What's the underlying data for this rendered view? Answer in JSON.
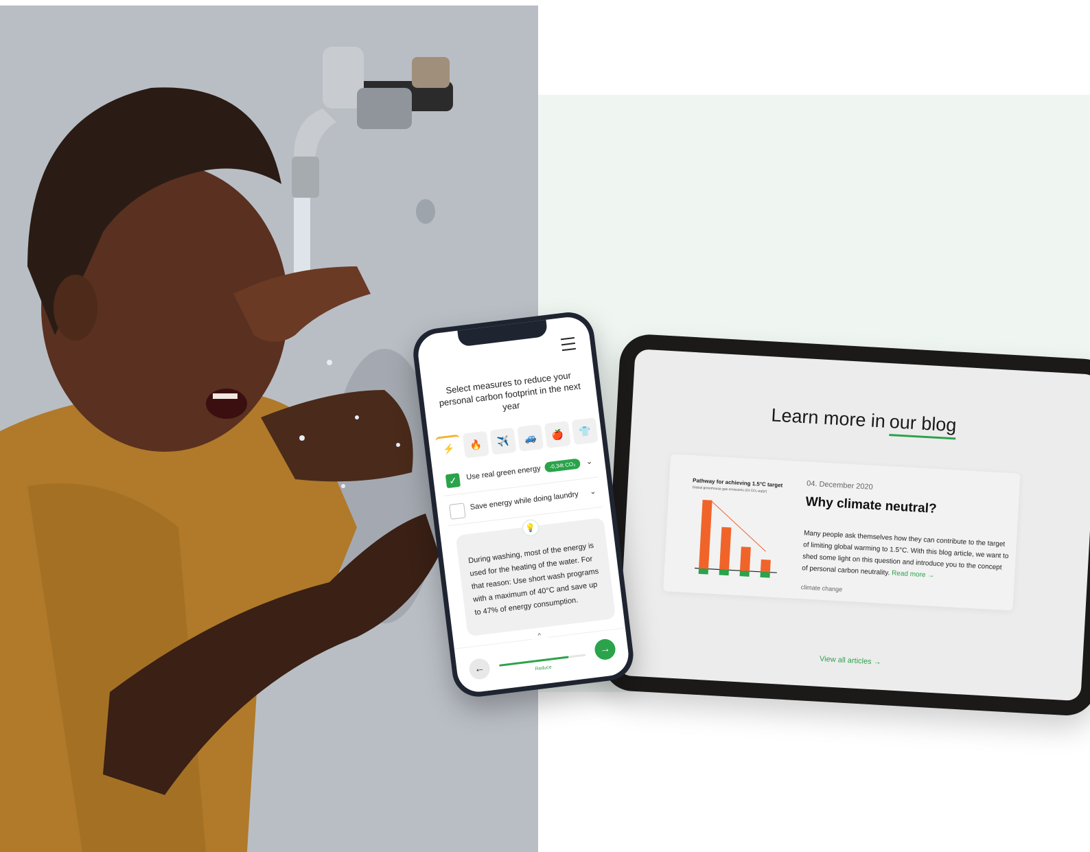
{
  "photo": {
    "alt_icon": "person-washing-face-photo"
  },
  "phone": {
    "title": "Select measures to reduce your personal carbon footprint in the next year",
    "categories": [
      "⚡",
      "🔥",
      "✈️",
      "🚙",
      "🍎",
      "👕"
    ],
    "measures": [
      {
        "label": "Use real green energy",
        "badge": "-0,34t CO₂",
        "checked": true
      },
      {
        "label": "Save energy while doing laundry",
        "checked": false
      }
    ],
    "tip": "During washing, most of the energy is used for the heating of the water. For that reason: Use short wash programs with a maximum of 40°C and save up to 47% of energy consumption.",
    "step_label": "Reduce",
    "progress": 0.8
  },
  "blog": {
    "heading_plain": "Learn more in",
    "heading_accent": "our blog",
    "post": {
      "date": "04. December 2020",
      "title": "Why climate neutral?",
      "excerpt": "Many people ask themselves how they can contribute to the target of limiting global warming to 1.5°C. With this blog article, we want to shed some light on this question and introduce you to the concept of personal carbon neutrality.",
      "read_more": "Read more →",
      "tag": "climate change"
    },
    "view_all": "View all articles →",
    "thumbnail": {
      "title": "Pathway for achieving 1.5°C target",
      "subtitle": "Global greenhouse gas emissions (Gt CO₂-eq/yr)"
    }
  },
  "colors": {
    "accent": "#2aa34a",
    "bar": "#f0642a",
    "panel": "#eff6f2"
  }
}
